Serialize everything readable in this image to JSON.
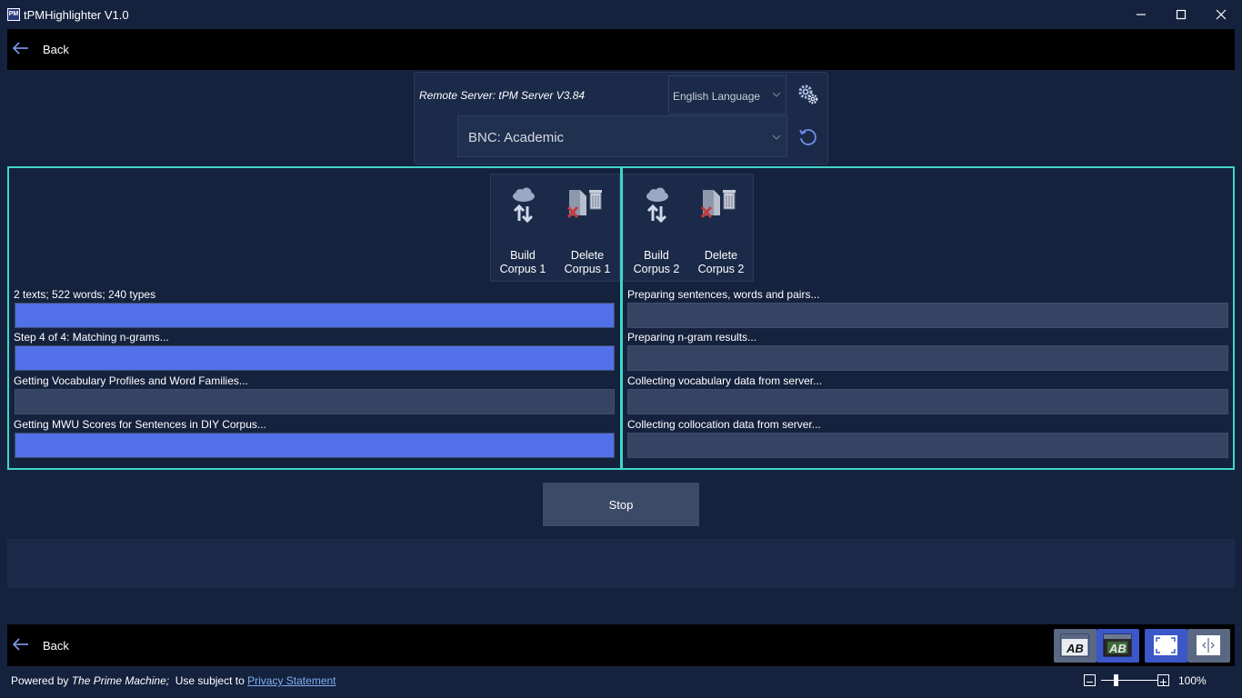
{
  "window": {
    "title": "tPMHighlighter V1.0",
    "app_icon_text": "PM"
  },
  "topbar": {
    "back_label": "Back"
  },
  "server": {
    "label": "Remote Server: tPM Server V3.84",
    "language": "English Language",
    "corpus": "BNC: Academic"
  },
  "corpus1": {
    "build_label_1": "Build",
    "build_label_2": "Corpus 1",
    "delete_label_1": "Delete",
    "delete_label_2": "Corpus 1",
    "tasks": [
      {
        "status": "2 texts; 522 words; 240 types",
        "progress": 1.0
      },
      {
        "status": "Step 4 of 4: Matching n-grams...",
        "progress": 1.0
      },
      {
        "status": "Getting Vocabulary Profiles and Word Families...",
        "progress": 0.0
      },
      {
        "status": "Getting MWU Scores for Sentences in DIY Corpus...",
        "progress": 1.0
      }
    ]
  },
  "corpus2": {
    "build_label_1": "Build",
    "build_label_2": "Corpus 2",
    "delete_label_1": "Delete",
    "delete_label_2": "Corpus 2",
    "tasks": [
      {
        "status": "Preparing sentences, words and pairs...",
        "progress": 0.0
      },
      {
        "status": "Preparing n-gram results...",
        "progress": 0.0
      },
      {
        "status": "Collecting vocabulary data from server...",
        "progress": 0.0
      },
      {
        "status": "Collecting collocation data from server...",
        "progress": 0.0
      }
    ]
  },
  "stop_label": "Stop",
  "bottombar": {
    "back_label": "Back",
    "view_buttons": [
      "ab-view-icon",
      "ab-highlight-icon",
      "fullscreen-icon",
      "split-view-icon"
    ]
  },
  "footer": {
    "powered_prefix": "Powered by ",
    "powered_name": "The Prime Machine;",
    "use_subject": "  Use subject to ",
    "privacy_link": "Privacy Statement",
    "zoom": "100%"
  },
  "colors": {
    "background": "#15223e",
    "accent_border": "#3fd6c8",
    "progress_fill": "#5271e8",
    "progress_track": "#344462"
  }
}
